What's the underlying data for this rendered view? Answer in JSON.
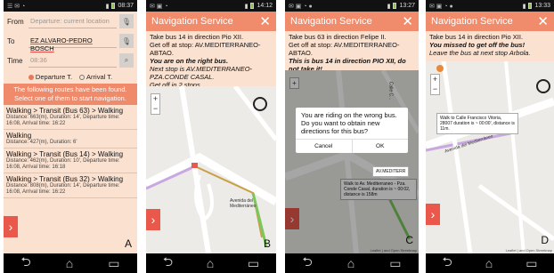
{
  "screenA": {
    "status_time": "08:37",
    "from_label": "From",
    "from_placeholder": "Departure: current location",
    "to_label": "To",
    "to_value": "EZ ALVARO-PEDRO BOSCH",
    "time_label": "Time",
    "time_placeholder": "08:36",
    "departure_label": "Departure T.",
    "arrival_label": "Arrival T.",
    "banner_line1": "The following routes have been found.",
    "banner_line2": "Select one of them to start navigation.",
    "routes": [
      {
        "title": "Walking > Transit (Bus 63) > Walking",
        "details": "Distance: 663(m), Duration: 14', Departure time: 16:08, Arrival time: 16:22"
      },
      {
        "title": "Walking",
        "details": "Distance: 427(m), Duration: 6'"
      },
      {
        "title": "Walking > Transit (Bus 14) > Walking",
        "details": "Distance: 462(m), Duration: 10', Departure time: 16:08, Arrival time: 16:18"
      },
      {
        "title": "Walking > Transit (Bus 32) > Walking",
        "details": "Distance: 808(m), Duration: 14', Departure time: 16:08, Arrival time: 16:22"
      }
    ],
    "next_glyph": "›",
    "letter": "A"
  },
  "screenB": {
    "status_time": "14:12",
    "title": "Navigation Service",
    "close_glyph": "✕",
    "line1": "Take bus 14 in direction Pio XII.",
    "line2": "Get off at stop: AV.MEDITERRANEO-ABTAO.",
    "line3": "You are on the right bus.",
    "line4": "Next stop is AV.MEDITERRANEO-PZA.CONDE CASAL.",
    "line5": "Get off in 2 stops.",
    "street": "Avenida del Mediterráneo",
    "letter": "B"
  },
  "screenC": {
    "status_time": "13:27",
    "title": "Navigation Service",
    "line1": "Take bus 63 in direction Felipe II.",
    "line2": "Get off at stop: AV.MEDITERRANEO-ABTAO.",
    "line3": "This is bus 14 in direction PIO XII, do not take it!",
    "dialog_msg": "You are riding on the wrong bus. Do you want to obtain new directions for this bus?",
    "cancel_label": "Cancel",
    "ok_label": "OK",
    "bubble": "Walk to Av. Mediterraneo - Pza. Conde Casal, duration is ~ 00:02, distance is 158m",
    "stop_label": "AV.MEDITERR",
    "street": "Calle C...",
    "credit": "Leaflet | and Open Streetmap",
    "letter": "C"
  },
  "screenD": {
    "status_time": "13:33",
    "title": "Navigation Service",
    "line1": "Take bus 14 in direction Pio XII.",
    "line2": "You missed to get off the bus!",
    "line3": "Leave the bus at next stop Arbola.",
    "bubble": "Walk to Calle Francisco Vitoria, 28007 duration is ~ 00:00', distance is 11m.",
    "street": "Avenida del Mediterráneo",
    "credit": "Leaflet | and Open Streetmap",
    "letter": "D"
  },
  "nav_glyphs": {
    "back": "⮌",
    "home": "⌂",
    "recent": "▭"
  },
  "colors": {
    "header": "#f08c6c",
    "panel": "#fbe1cf",
    "accent": "#e9584a"
  }
}
